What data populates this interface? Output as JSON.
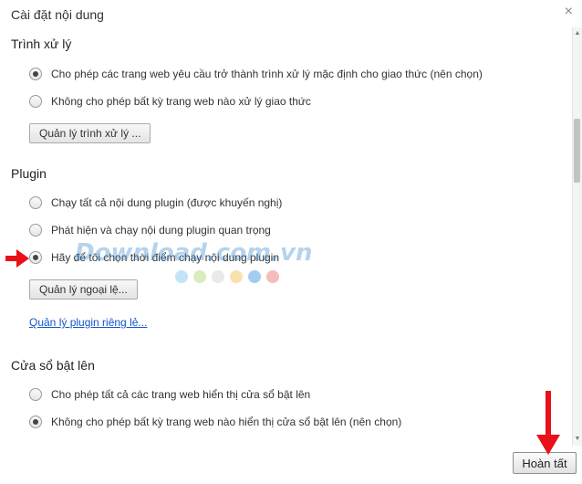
{
  "dialog": {
    "title": "Cài đặt nội dung",
    "done_label": "Hoàn tất"
  },
  "handlers": {
    "title": "Trình xử lý",
    "options": [
      {
        "label": "Cho phép các trang web yêu cầu trở thành trình xử lý mặc định cho giao thức (nên chọn)",
        "checked": true
      },
      {
        "label": "Không cho phép bất kỳ trang web nào xử lý giao thức",
        "checked": false
      }
    ],
    "manage_button": "Quản lý trình xử lý ..."
  },
  "plugins": {
    "title": "Plugin",
    "options": [
      {
        "label": "Chạy tất cả nội dung plugin (được khuyến nghị)",
        "checked": false
      },
      {
        "label": "Phát hiện và chạy nội dung plugin quan trọng",
        "checked": false
      },
      {
        "label": "Hãy để tôi chọn thời điểm chạy nội dung plugin",
        "checked": true
      }
    ],
    "manage_exceptions_button": "Quản lý ngoại lệ...",
    "manage_individual_link": "Quản lý plugin riêng lẻ..."
  },
  "popups": {
    "title": "Cửa sổ bật lên",
    "options": [
      {
        "label": "Cho phép tất cả các trang web hiển thị cửa sổ bật lên",
        "checked": false
      },
      {
        "label": "Không cho phép bất kỳ trang web nào hiển thị cửa sổ bật lên (nên chọn)",
        "checked": true
      }
    ]
  },
  "watermark": {
    "text": "Download.com.vn",
    "dot_colors": [
      "#a8d8f0",
      "#c8e6a0",
      "#e0e0e0",
      "#f6d48a",
      "#7ab8e8",
      "#f2a0a0"
    ]
  },
  "annotation": {
    "arrow_color": "#e8101a"
  }
}
